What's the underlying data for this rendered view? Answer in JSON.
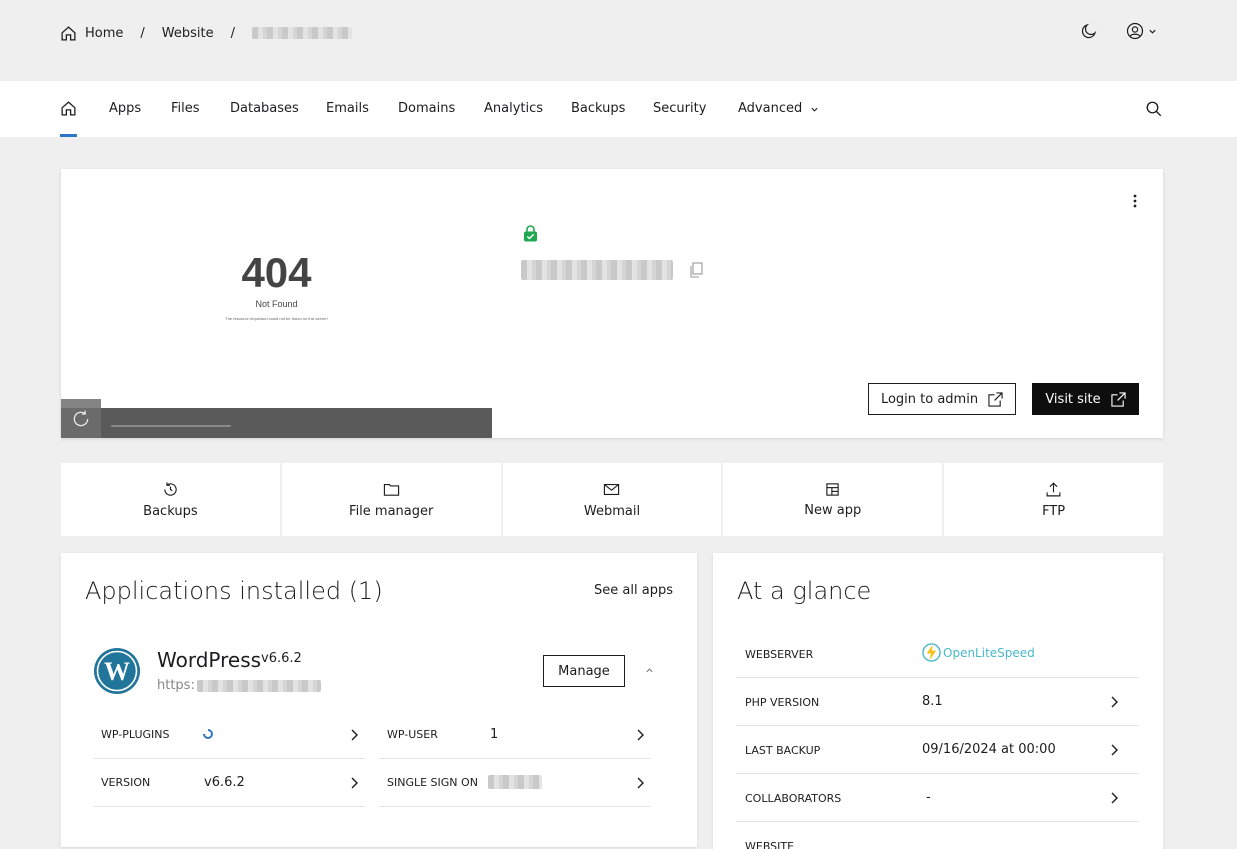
{
  "breadcrumb": {
    "home": "Home",
    "website": "Website",
    "separator": "/"
  },
  "nav": {
    "tabs": [
      "Apps",
      "Files",
      "Databases",
      "Emails",
      "Domains",
      "Analytics",
      "Backups",
      "Security",
      "Advanced"
    ]
  },
  "preview": {
    "code": "404",
    "status": "Not Found",
    "message": "The resource requested could not be found on this server!"
  },
  "site_actions": {
    "login_admin": "Login to admin",
    "visit_site": "Visit site"
  },
  "quick_actions": [
    {
      "label": "Backups",
      "icon": "history-icon"
    },
    {
      "label": "File manager",
      "icon": "folder-icon"
    },
    {
      "label": "Webmail",
      "icon": "mail-icon"
    },
    {
      "label": "New app",
      "icon": "layout-icon"
    },
    {
      "label": "FTP",
      "icon": "upload-icon"
    }
  ],
  "apps": {
    "title": "Applications installed (1)",
    "see_all": "See all apps",
    "app": {
      "name": "WordPress",
      "version": "v6.6.2",
      "url_prefix": "https:",
      "manage": "Manage"
    },
    "stats": {
      "plugins_label": "WP-PLUGINS",
      "user_label": "WP-USER",
      "user_value": "1",
      "version_label": "VERSION",
      "version_value": "v6.6.2",
      "sso_label": "SINGLE SIGN ON"
    }
  },
  "glance": {
    "title": "At a glance",
    "rows": {
      "webserver_label": "WEBSERVER",
      "webserver_value": "OpenLiteSpeed",
      "php_label": "PHP VERSION",
      "php_value": "8.1",
      "backup_label": "LAST BACKUP",
      "backup_value": "09/16/2024 at 00:00",
      "collab_label": "COLLABORATORS",
      "collab_value": "-",
      "website_label": "WEBSITE"
    }
  },
  "colors": {
    "accent": "#2c76c9",
    "lock_green": "#1fa84f",
    "wp_blue": "#21759b",
    "ols_teal": "#49b9c9"
  }
}
